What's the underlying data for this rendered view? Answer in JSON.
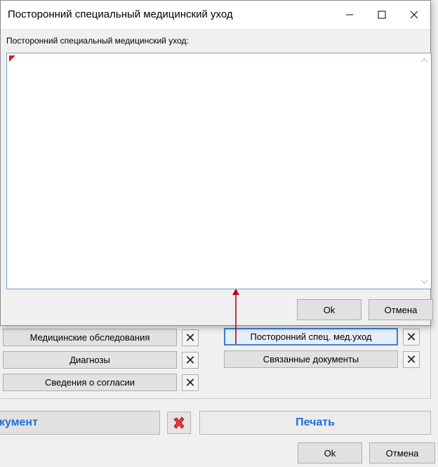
{
  "dialog": {
    "title": "Посторонний специальный медицинский уход",
    "field_label": "Посторонний специальный медицинский уход:",
    "text_value": "",
    "ok_label": "Ok",
    "cancel_label": "Отмена"
  },
  "background": {
    "left_buttons": [
      "Медицинские обследования",
      "Диагнозы",
      "Сведения о согласии"
    ],
    "right_buttons": [
      "Посторонний спец. мед.уход",
      "Связанные документы"
    ],
    "document_button": "кумент",
    "print_button": "Печать",
    "ok_label": "Ok",
    "cancel_label": "Отмена"
  },
  "colors": {
    "accent": "#1f6fd8",
    "annotation_arrow": "#c0001a",
    "focus_border": "#3c7fd1"
  }
}
